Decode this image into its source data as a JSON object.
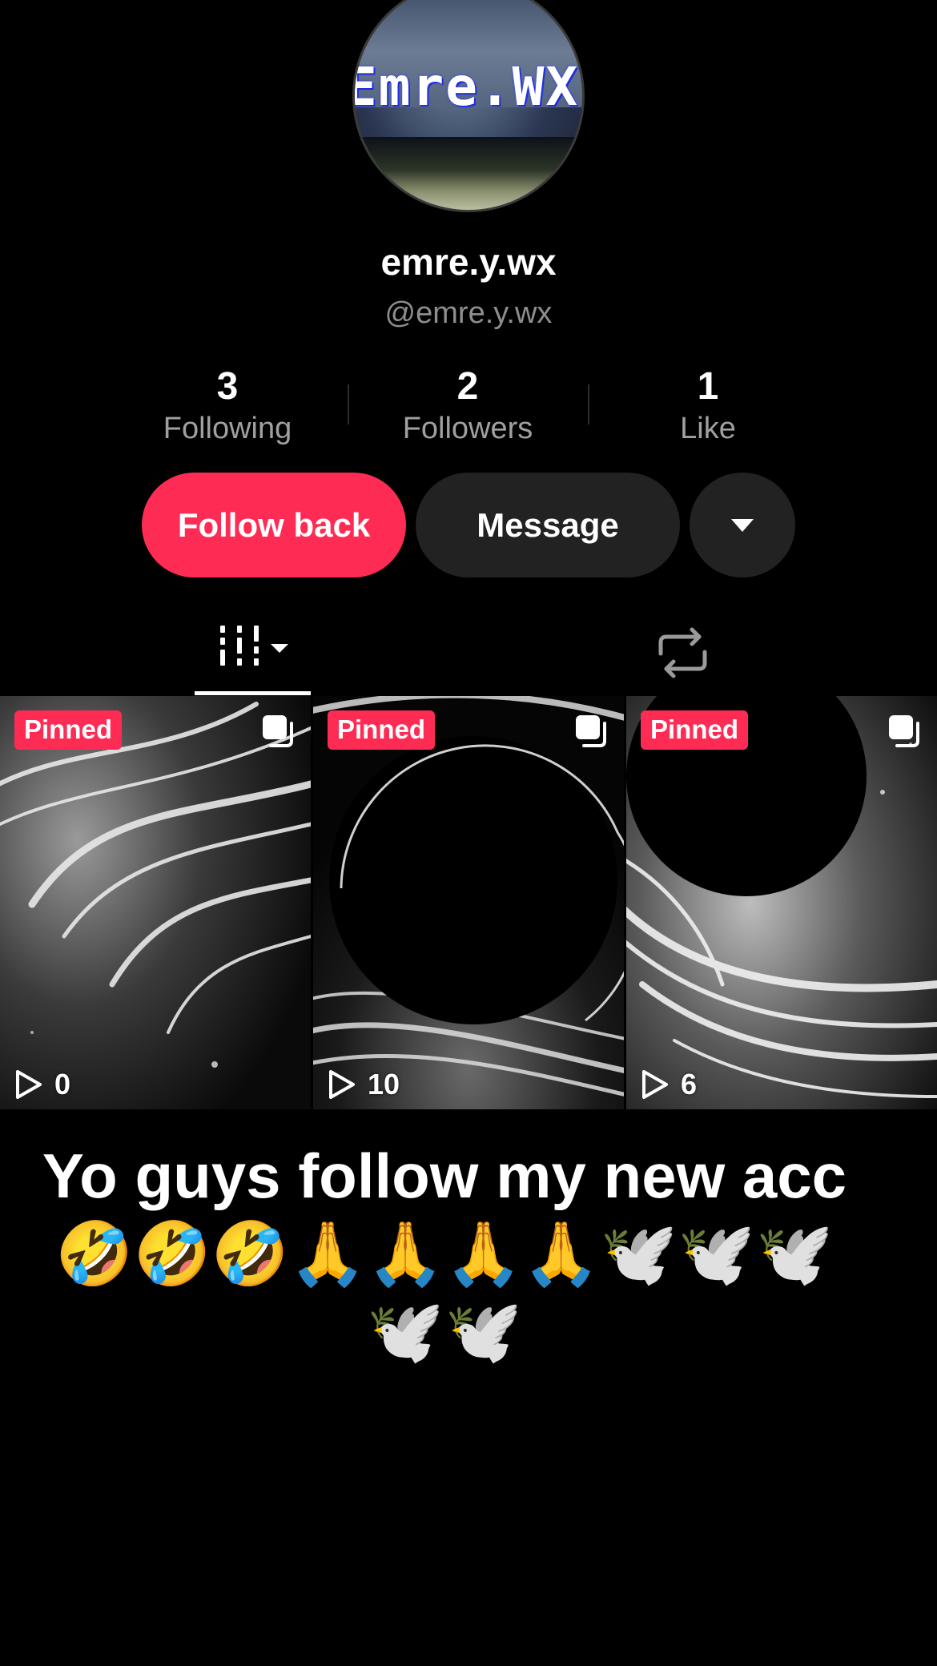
{
  "profile": {
    "avatar_text": "Emre.WX",
    "display_name": "emre.y.wx",
    "handle": "@emre.y.wx"
  },
  "stats": {
    "following": {
      "value": "3",
      "label": "Following"
    },
    "followers": {
      "value": "2",
      "label": "Followers"
    },
    "likes": {
      "value": "1",
      "label": "Like"
    }
  },
  "actions": {
    "follow_back_label": "Follow back",
    "message_label": "Message",
    "more_icon": "caret-down-icon"
  },
  "tabs": {
    "videos_icon": "videos-grid-icon",
    "reposts_icon": "repost-icon"
  },
  "videos": [
    {
      "badge": "Pinned",
      "views": "0"
    },
    {
      "badge": "Pinned",
      "views": "10"
    },
    {
      "badge": "Pinned",
      "views": "6"
    }
  ],
  "caption": "Yo guys follow my new acc🤣🤣🤣🙏🙏🙏🙏🕊️🕊️🕊️🕊️🕊️",
  "colors": {
    "accent": "#fe2c55",
    "secondary_button": "#222222",
    "background": "#000000"
  }
}
